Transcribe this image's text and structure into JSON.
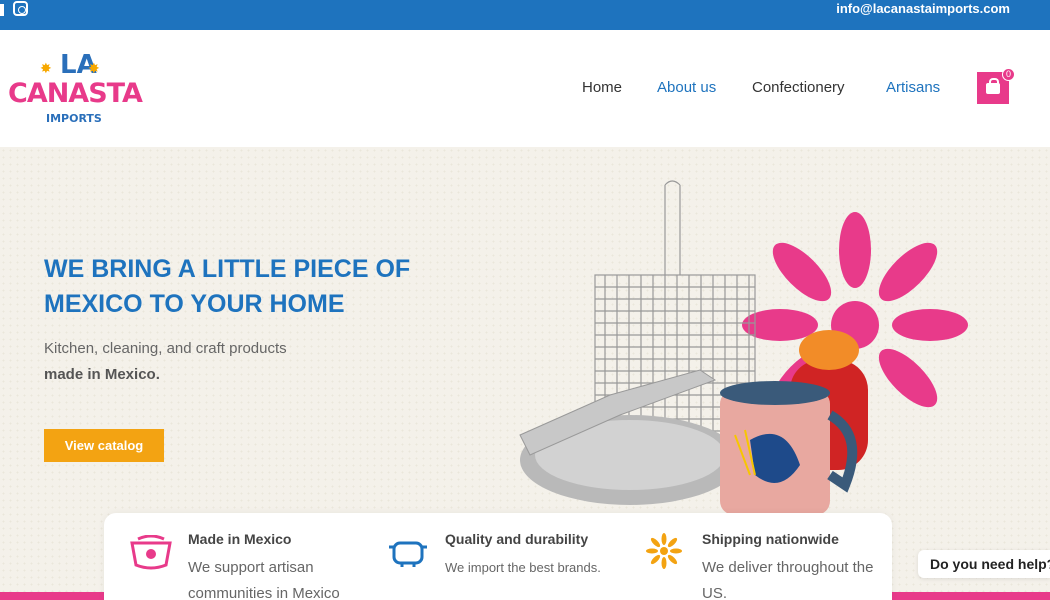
{
  "topbar": {
    "email": "info@lacanastaimports.com",
    "icons": [
      "facebook-icon",
      "instagram-icon"
    ]
  },
  "logo": {
    "line1": "LA",
    "line2": "CANASTA",
    "line3": "IMPORTS"
  },
  "nav": {
    "items": [
      {
        "label": "Home"
      },
      {
        "label": "About us"
      },
      {
        "label": "Confectionery"
      },
      {
        "label": "Artisans"
      }
    ]
  },
  "cart": {
    "count": "0",
    "icon": "shopping-bag-icon"
  },
  "hero": {
    "headline": "WE BRING A LITTLE PIECE OF MEXICO TO YOUR HOME",
    "subline": "Kitchen, cleaning, and craft products",
    "subline_bold": "made in Mexico.",
    "cta_label": "View catalog"
  },
  "features": [
    {
      "icon": "basket-icon",
      "title": "Made in Mexico",
      "desc": "We support artisan communities in Mexico"
    },
    {
      "icon": "pot-icon",
      "title": "Quality and durability",
      "desc": "We import the best brands."
    },
    {
      "icon": "sun-flower-icon",
      "title": "Shipping nationwide",
      "desc": "We deliver throughout the US."
    }
  ],
  "help": {
    "label": "Do you need help?"
  },
  "colors": {
    "brand_blue": "#1e73be",
    "brand_pink": "#e83a8a",
    "brand_orange": "#f3a312",
    "logo_blue": "#2a6fba",
    "hero_bg": "#f4f1ea"
  }
}
